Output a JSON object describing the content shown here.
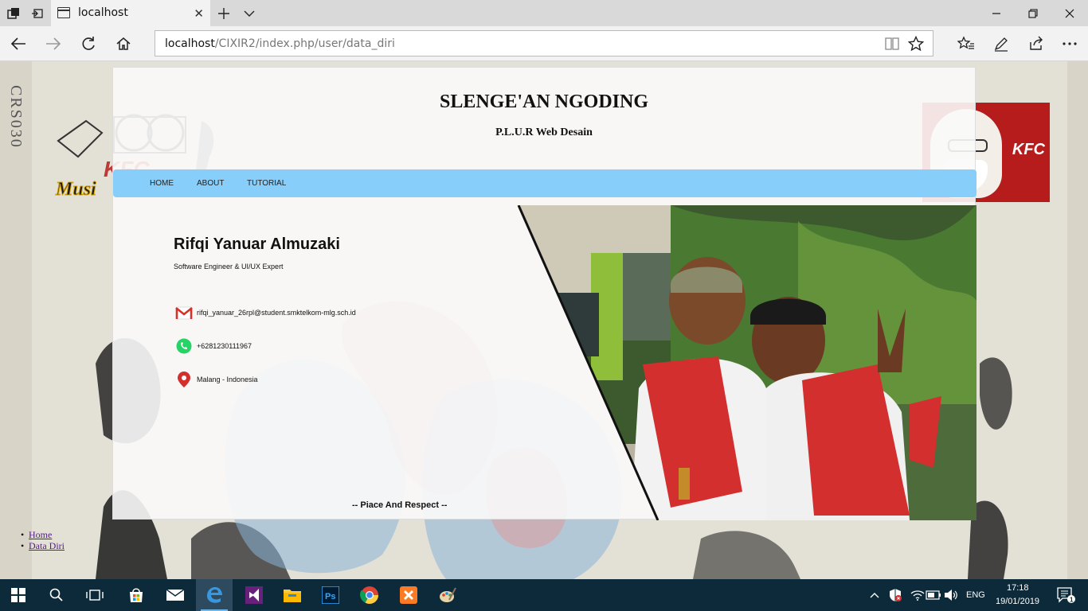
{
  "browser": {
    "tab_title": "localhost",
    "url_host": "localhost",
    "url_path": "/CIXIR2/index.php/user/data_diri"
  },
  "site": {
    "title": "SLENGE'AN NGODING",
    "subtitle": "P.L.U.R Web Desain",
    "menu": [
      "HOME",
      "ABOUT",
      "TUTORIAL"
    ]
  },
  "profile": {
    "name": "Rifqi Yanuar Almuzaki",
    "role": "Software Engineer & UI/UX Expert",
    "email": "rifqi_yanuar_26rpl@student.smktelkom-mlg.sch.id",
    "phone": "+6281230111967",
    "location": "Malang - Indonesia",
    "motto": "-- Piace And Respect --"
  },
  "background": {
    "vertical_text": "CRS030",
    "kfc_right_text": "KFC",
    "kfc_left_text": "KFC",
    "music_text": "Musi"
  },
  "page_links": [
    "Home",
    "Data Diri"
  ],
  "taskbar": {
    "language": "ENG",
    "time": "17:18",
    "date": "19/01/2019",
    "notifications": "1"
  },
  "colors": {
    "menu_bg": "#87cefa",
    "taskbar_bg": "#0d2a3a",
    "link": "#551a8b"
  }
}
